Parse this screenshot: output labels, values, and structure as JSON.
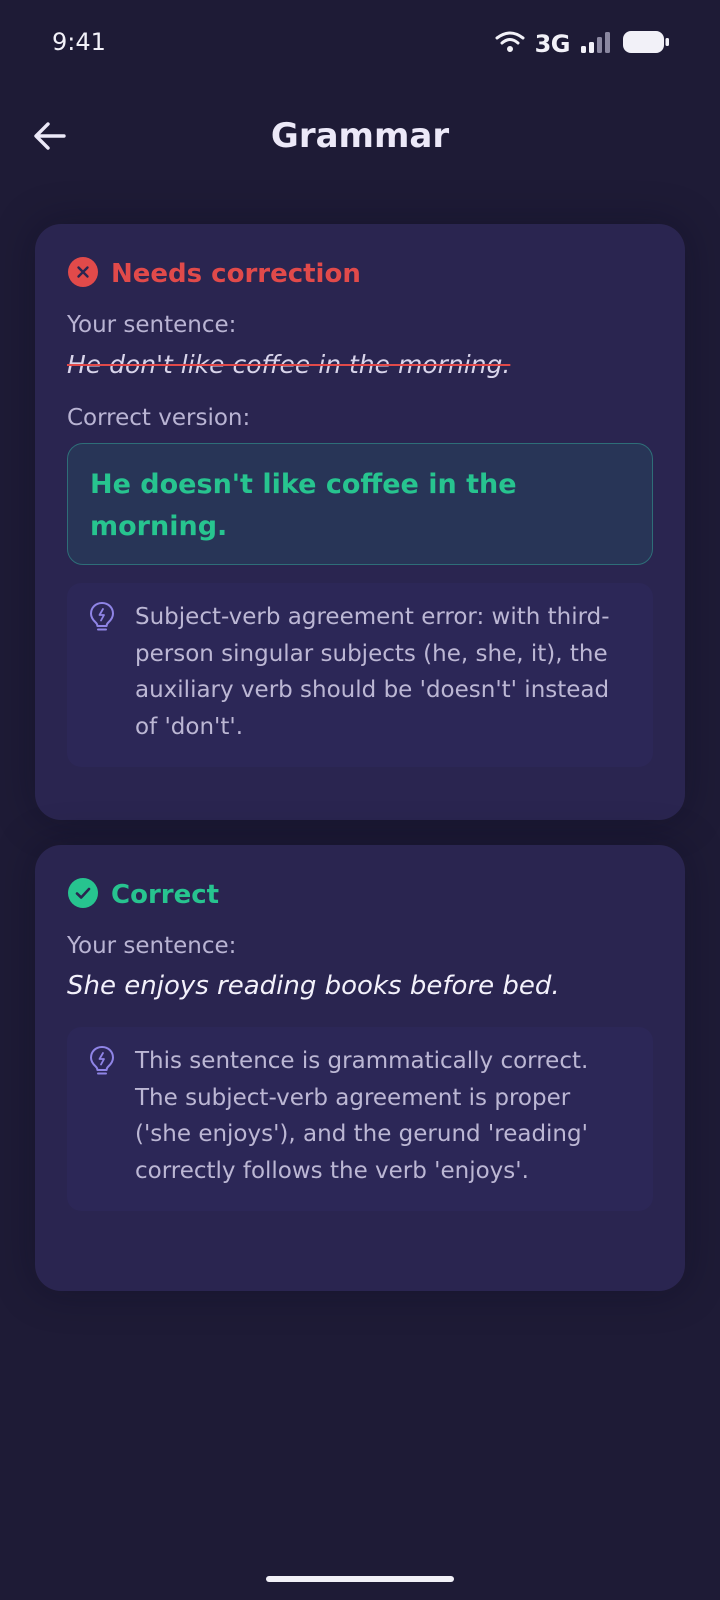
{
  "status_bar": {
    "time": "9:41",
    "network": "3G"
  },
  "header": {
    "title": "Grammar"
  },
  "colors": {
    "background": "#1e1b36",
    "card": "#2a2550",
    "error": "#e14a4a",
    "success": "#27c48f",
    "icon_accent": "#8f84e6"
  },
  "results": [
    {
      "status": "Needs correction",
      "status_icon": "x-circle-icon",
      "your_sentence_label": "Your sentence:",
      "sentence": "He don't like coffee in the morning.",
      "correct_label": "Correct version:",
      "correct_sentence": "He doesn't like coffee in the morning.",
      "explanation_icon": "lightbulb-icon",
      "explanation": "Subject-verb agreement error: with third-person singular subjects (he, she, it), the auxiliary verb should be 'doesn't' instead of 'don't'."
    },
    {
      "status": "Correct",
      "status_icon": "check-circle-icon",
      "your_sentence_label": "Your sentence:",
      "sentence": "She enjoys reading books before bed.",
      "explanation_icon": "lightbulb-icon",
      "explanation": "This sentence is grammatically correct. The subject-verb agreement is proper ('she enjoys'), and the gerund 'reading' correctly follows the verb 'enjoys'."
    }
  ]
}
